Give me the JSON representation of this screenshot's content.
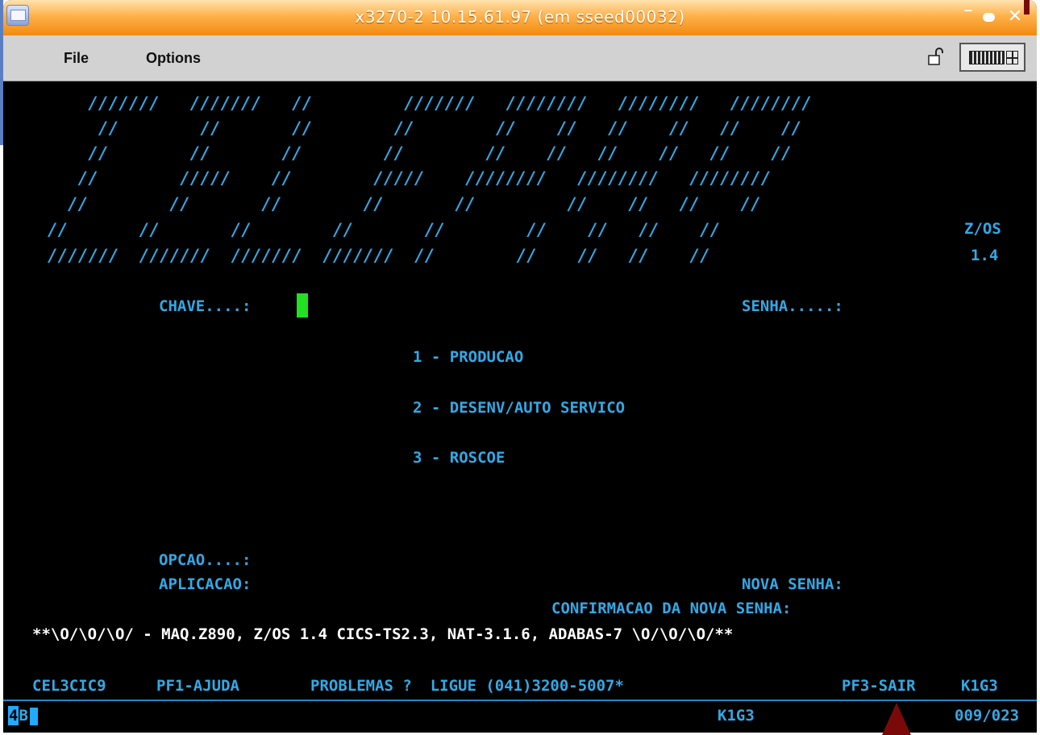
{
  "window": {
    "title": "x3270-2 10.15.61.97 (em sseed00032)",
    "accent": "#f08a10"
  },
  "menubar": {
    "file": "File",
    "options": "Options"
  },
  "logo": {
    "rows": [
      "  ///////   ///////   //         ///////   ////////   ////////   ////////",
      "   //        //       //        //        //    //   //    //   //    //",
      "  //        //       //        //        //    //   //    //   //    //",
      " //        /////    //        /////    ////////   ////////   ////////",
      "//        //       //        //       //         //    //   //    //",
      "//       //       //        //       //        //    //   //    //",
      "///////  ///////  ///////  ///////  //        //    //   //    //"
    ],
    "os_label": "Z/OS",
    "os_version": "1.4"
  },
  "login": {
    "chave_label": "CHAVE....:",
    "senha_label": "SENHA.....:",
    "opcao_label": "OPCAO....:",
    "aplicacao_label": "APLICACAO:",
    "nova_senha_label": "NOVA SENHA:",
    "confirmacao_label": "CONFIRMACAO DA NOVA SENHA:"
  },
  "options": [
    "1 - PRODUCAO",
    "2 - DESENV/AUTO SERVICO",
    "3 - ROSCOE"
  ],
  "system_banner": "**\\O/\\O/\\O/ - MAQ.Z890, Z/OS 1.4 CICS-TS2.3, NAT-3.1.6, ADABAS-7 \\O/\\O/\\O/**",
  "footer": {
    "terminal_id": "CEL3CIC9",
    "pf1": "PF1-AJUDA",
    "problemas": "PROBLEMAS ?  LIGUE (041)3200-5007*",
    "pf3": "PF3-SAIR",
    "node": "K1G3"
  },
  "status_line": {
    "oia_4": "4",
    "oia_b": "B",
    "node": "K1G3",
    "cursor_pos": "009/023"
  },
  "colors": {
    "screen_bg": "#000000",
    "field_text": "#32a9e6",
    "cursor": "#22e022"
  }
}
